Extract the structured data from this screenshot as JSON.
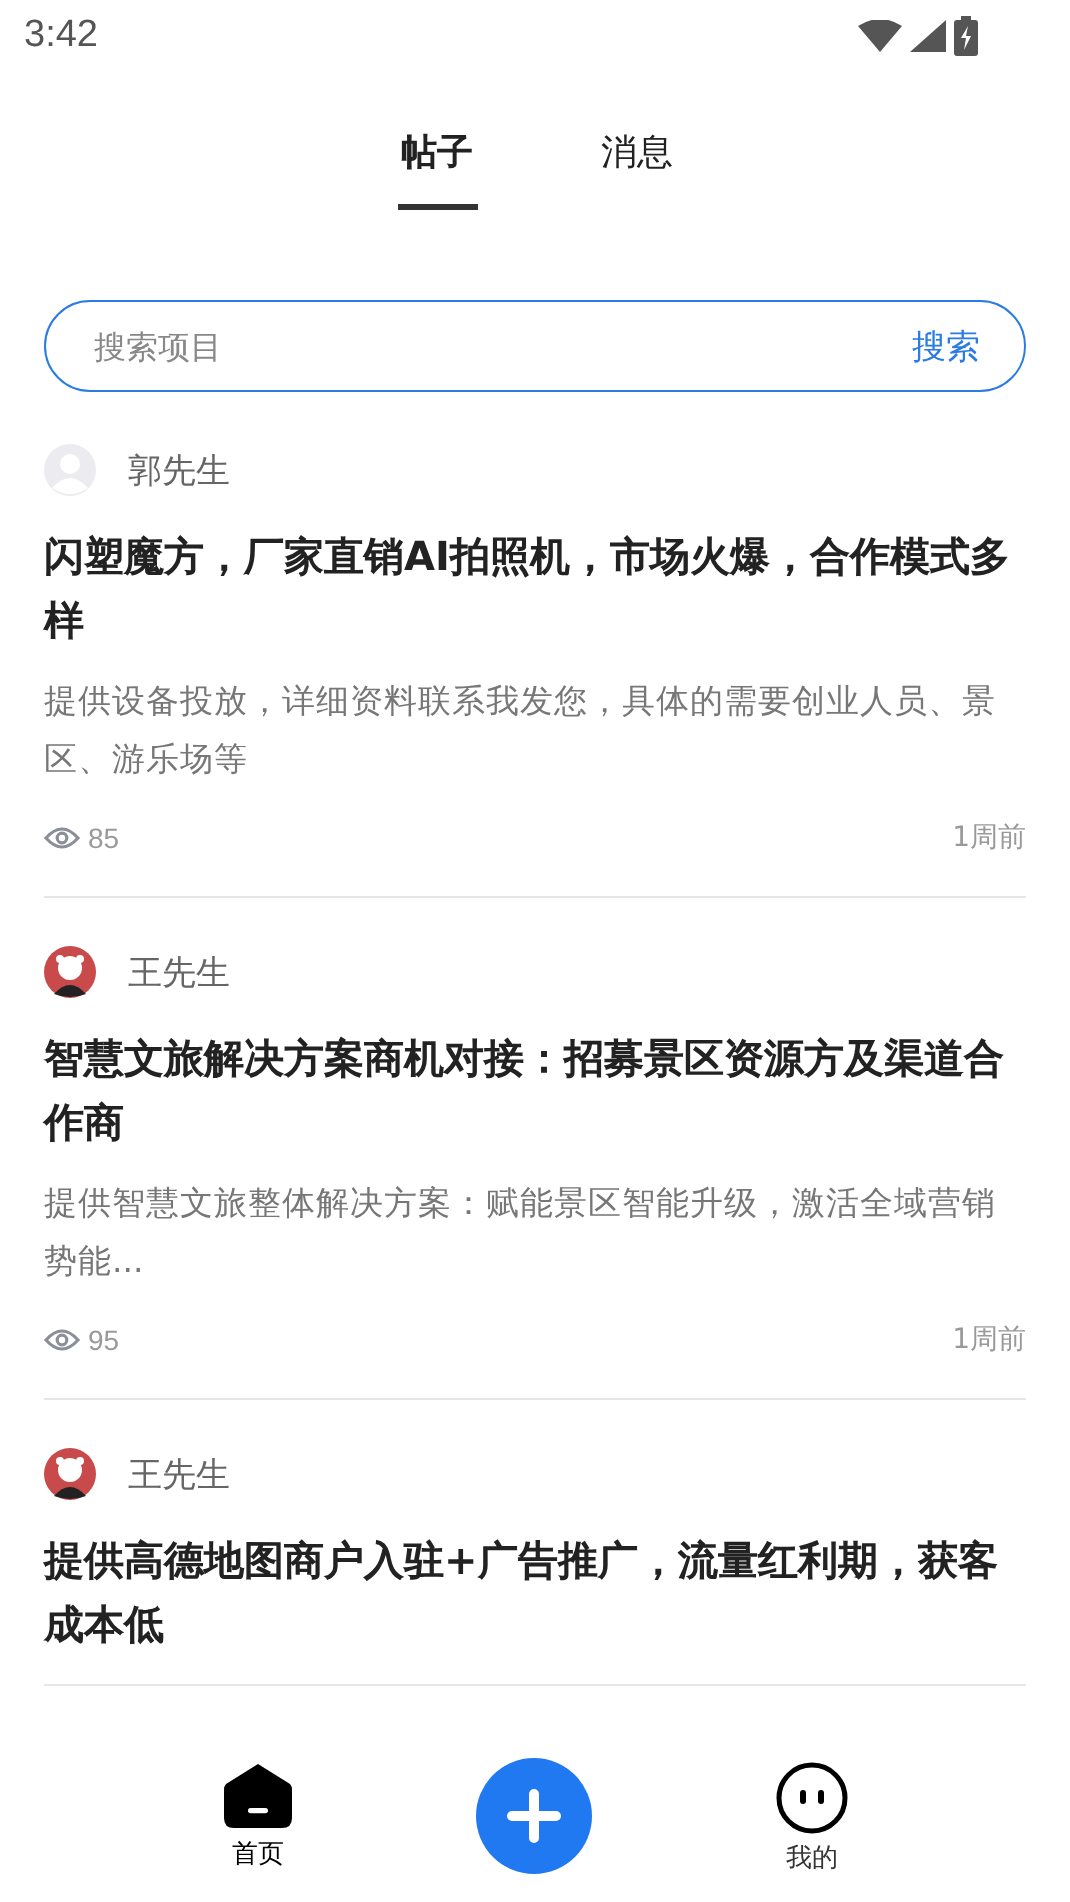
{
  "status_bar": {
    "time": "3:42"
  },
  "tabs": [
    {
      "label": "帖子",
      "selected": true
    },
    {
      "label": "消息",
      "selected": false
    }
  ],
  "search": {
    "placeholder": "搜索项目",
    "button": "搜索"
  },
  "posts": [
    {
      "author": "郭先生",
      "avatar": {
        "kind": "default"
      },
      "title": "闪塑魔方，厂家直销AI拍照机，市场火爆，合作模式多样",
      "excerpt": "提供设备投放，详细资料联系我发您，具体的需要创业人员、景区、游乐场等",
      "views": "85",
      "time": "1周前"
    },
    {
      "author": "王先生",
      "avatar": {
        "kind": "photo"
      },
      "title": "智慧文旅解决方案商机对接：招募景区资源方及渠道合作商",
      "excerpt": "提供智慧文旅整体解决方案：赋能景区智能升级，激活全域营销势能...",
      "views": "95",
      "time": "1周前"
    },
    {
      "author": "王先生",
      "avatar": {
        "kind": "photo"
      },
      "title": "提供高德地图商户入驻+广告推广，流量红利期，获客成本低"
    }
  ],
  "bottom_nav": [
    {
      "kind": "home",
      "label": "首页",
      "selected": true
    },
    {
      "kind": "add"
    },
    {
      "kind": "profile",
      "label": "我的",
      "selected": false
    }
  ]
}
